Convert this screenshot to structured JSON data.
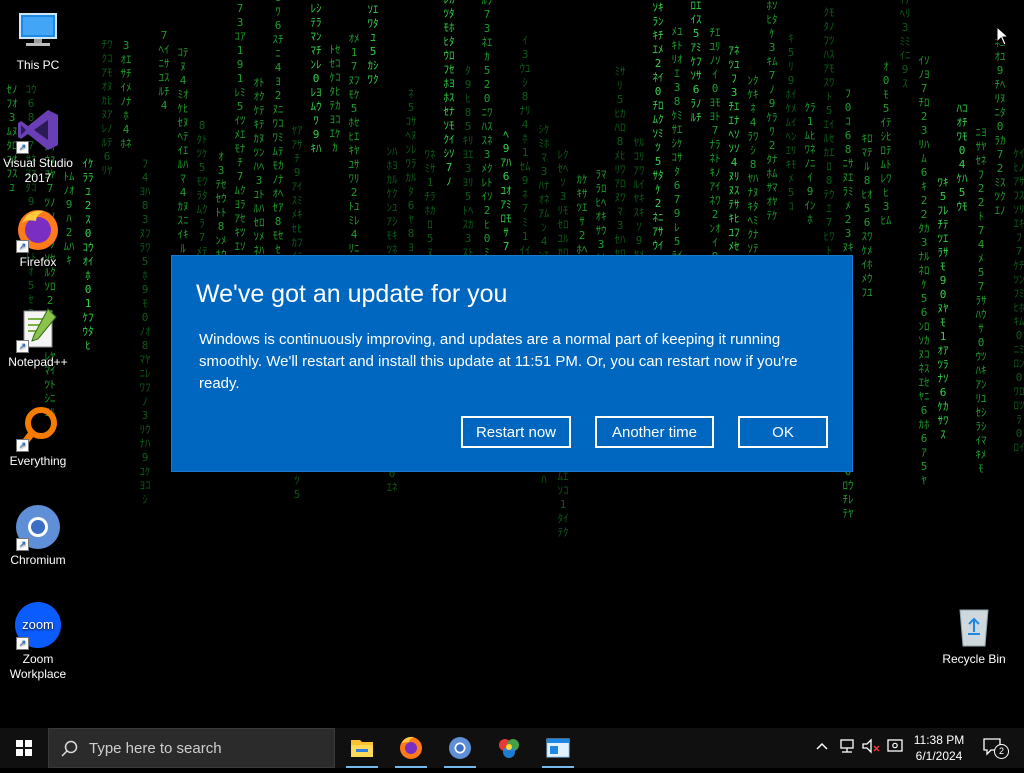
{
  "desktop": {
    "icons": [
      {
        "label": "This PC"
      },
      {
        "label": "Visual Studio 2017"
      },
      {
        "label": "Firefox"
      },
      {
        "label": "Notepad++"
      },
      {
        "label": "Everything"
      },
      {
        "label": "Chromium"
      },
      {
        "label": "Zoom Workplace"
      },
      {
        "label": "Recycle Bin"
      }
    ],
    "zoom_icon_text": "zoom"
  },
  "dialog": {
    "title": "We've got an update for you",
    "body": "Windows is continuously improving, and updates are a normal part of keeping it running smoothly. We'll restart and install this update at 11:51 PM. Or, you can restart now if you're ready.",
    "buttons": {
      "restart_now": "Restart now",
      "another_time": "Another time",
      "ok": "OK"
    }
  },
  "taskbar": {
    "search_placeholder": "Type here to search",
    "apps": [
      "file-explorer-icon",
      "firefox-icon",
      "chromium-icon",
      "color-app-icon",
      "window-app-icon"
    ],
    "clock_time": "11:38 PM",
    "clock_date": "6/1/2024",
    "notification_count": "2"
  },
  "colors": {
    "dialog_bg": "#0067c0",
    "matrix_green": "#1f9c2c",
    "taskbar_bg": "#101010"
  }
}
